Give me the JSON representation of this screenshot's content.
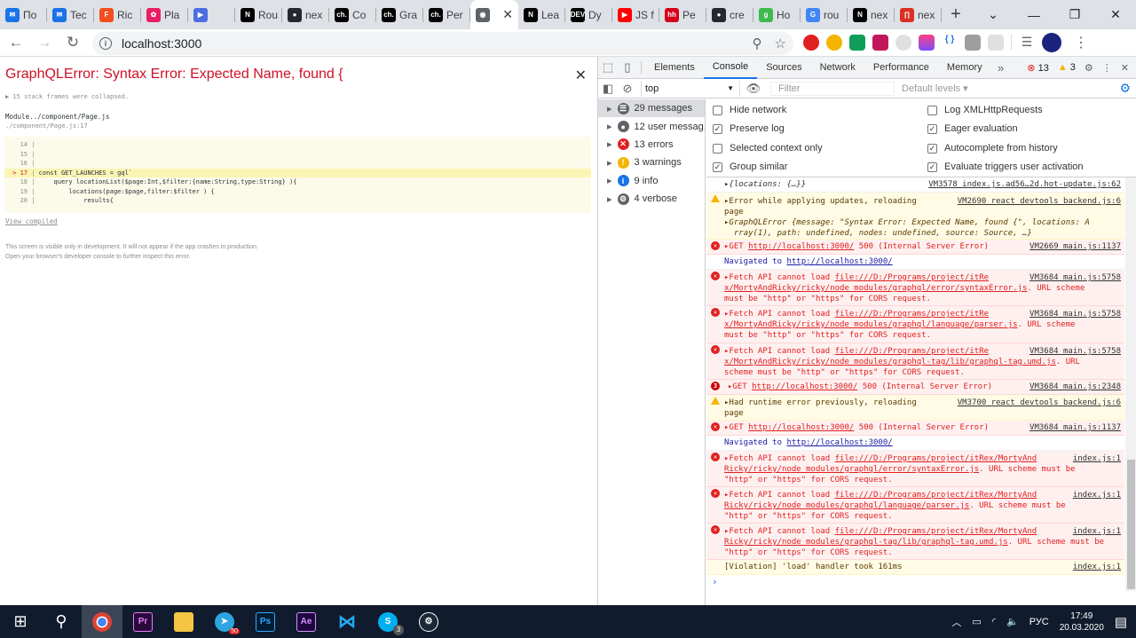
{
  "tabs": [
    {
      "label": "По",
      "color": "#1a73e8",
      "glyph": "✉"
    },
    {
      "label": "Tec",
      "color": "#1a73e8",
      "glyph": "✉"
    },
    {
      "label": "Ric",
      "color": "#f24e1e",
      "glyph": "F"
    },
    {
      "label": "Pla",
      "color": "#e91e63",
      "glyph": "✿"
    },
    {
      "label": "",
      "color": "#4a6ee0",
      "glyph": "▶"
    },
    {
      "label": "Rou",
      "color": "#000000",
      "glyph": "N"
    },
    {
      "label": "nex",
      "color": "#24292e",
      "glyph": "●"
    },
    {
      "label": "Co",
      "color": "#000000",
      "glyph": "ch."
    },
    {
      "label": "Gra",
      "color": "#000000",
      "glyph": "ch."
    },
    {
      "label": "Per",
      "color": "#000000",
      "glyph": "ch."
    },
    {
      "label": "",
      "color": "#5f6368",
      "glyph": "◉",
      "active": true
    },
    {
      "label": "Lea",
      "color": "#000000",
      "glyph": "N"
    },
    {
      "label": "Dy",
      "color": "#000000",
      "glyph": "DEV"
    },
    {
      "label": "JS f",
      "color": "#ff0000",
      "glyph": "▶"
    },
    {
      "label": "Pe",
      "color": "#d6001c",
      "glyph": "hh"
    },
    {
      "label": "cre",
      "color": "#24292e",
      "glyph": "●"
    },
    {
      "label": "Ho",
      "color": "#3dba4e",
      "glyph": "g"
    },
    {
      "label": "rou",
      "color": "#4285f4",
      "glyph": "G"
    },
    {
      "label": "nex",
      "color": "#000000",
      "glyph": "N"
    },
    {
      "label": "nex",
      "color": "#d93025",
      "glyph": "∏"
    }
  ],
  "toolbar": {
    "url": "localhost:3000"
  },
  "error_overlay": {
    "title": "GraphQLError: Syntax Error: Expected Name, found {",
    "collapsed": "▶ 15 stack frames were collapsed.",
    "module": "Module../component/Page.js",
    "module_path": "./component/Page.js:17",
    "code": [
      {
        "n": "14",
        "t": ""
      },
      {
        "n": "15",
        "t": ""
      },
      {
        "n": "16",
        "t": ""
      },
      {
        "n": "> 17",
        "t": "const GET_LAUNCHES = gql`"
      },
      {
        "n": "18",
        "t": "    query locationList($page:Int,$filter:{name:String,type:String} ){"
      },
      {
        "n": "19",
        "t": "        locations(page:$page,filter:$filter ) {"
      },
      {
        "n": "20",
        "t": "            results{"
      }
    ],
    "view_compiled": "View compiled",
    "note1": "This screen is visible only in development. It will not appear if the app crashes in production.",
    "note2": "Open your browser's developer console to further inspect this error."
  },
  "devtools": {
    "tabs": [
      "Elements",
      "Console",
      "Sources",
      "Network",
      "Performance",
      "Memory"
    ],
    "error_count": "13",
    "warn_count": "3",
    "context": "top",
    "filter_placeholder": "Filter",
    "levels": "Default levels ▾",
    "sidebar": [
      {
        "label": "29 messages",
        "icon": "☰",
        "color": "#5f6368"
      },
      {
        "label": "12 user messag...",
        "icon": "●",
        "color": "#5f6368"
      },
      {
        "label": "13 errors",
        "icon": "✕",
        "color": "#e02020"
      },
      {
        "label": "3 warnings",
        "icon": "!",
        "color": "#f4b400"
      },
      {
        "label": "9 info",
        "icon": "i",
        "color": "#1a73e8"
      },
      {
        "label": "4 verbose",
        "icon": "⚙",
        "color": "#5f6368"
      }
    ],
    "settings": {
      "hide_network": "Hide network",
      "preserve_log": "Preserve log",
      "selected_context": "Selected context only",
      "group_similar": "Group similar",
      "log_xhr": "Log XMLHttpRequests",
      "eager_eval": "Eager evaluation",
      "autocomplete": "Autocomplete from history",
      "eval_triggers": "Evaluate triggers user activation"
    },
    "messages": {
      "m0_text": "▸{locations: {…}}",
      "m0_src": "VM3578 index.js.ad56…2d.hot-update.js:62",
      "m1_text": "▸Error while applying updates, reloading",
      "m1_src": "VM2690 react devtools backend.js:6",
      "m1_text2": "page",
      "m1_text3": "▸GraphQLError {message: \"Syntax Error: Expected Name, found {\", locations: A",
      "m1_text4": "  rray(1), path: undefined, nodes: undefined, source: Source, …}",
      "m2_text": "▸GET",
      "m2_url": "http://localhost:3000/",
      "m2_rest": "500 (Internal Server Error)",
      "m2_src": "VM2669 main.js:1137",
      "m3_text": "Navigated to",
      "m3_url": "http://localhost:3000/",
      "m4_a": "▸Fetch API cannot load",
      "m4_b": "file:///D:/Programs/project/itRe",
      "m4_src": "VM3684 main.js:5758",
      "m4_c": "x/MortyAndRicky/ricky/node_modules/graphql/error/syntaxError.js",
      "m4_d": ". URL scheme",
      "m4_e": "must be \"http\" or \"https\" for CORS request.",
      "m5_a": "▸Fetch API cannot load",
      "m5_b": "file:///D:/Programs/project/itRe",
      "m5_src": "VM3684 main.js:5758",
      "m5_c": "x/MortyAndRicky/ricky/node_modules/graphql/language/parser.js",
      "m5_d": ". URL scheme",
      "m5_e": "must be \"http\" or \"https\" for CORS request.",
      "m6_a": "▸Fetch API cannot load",
      "m6_b": "file:///D:/Programs/project/itRe",
      "m6_src": "VM3684 main.js:5758",
      "m6_c": "x/MortyAndRicky/ricky/node_modules/graphql-tag/lib/graphql-tag.umd.js",
      "m6_d": ". URL",
      "m6_e": "scheme must be \"http\" or \"https\" for CORS request.",
      "m7_count": "3",
      "m7_text": "▸GET",
      "m7_url": "http://localhost:3000/",
      "m7_rest": "500 (Internal Server Error)",
      "m7_src": "VM3684 main.js:2348",
      "m8_text": "▸Had runtime error previously, reloading",
      "m8_src": "VM3700 react devtools backend.js:6",
      "m8_text2": "page",
      "m9_text": "▸GET",
      "m9_url": "http://localhost:3000/",
      "m9_rest": "500 (Internal Server Error)",
      "m9_src": "VM3684 main.js:1137",
      "m10_text": "Navigated to",
      "m10_url": "http://localhost:3000/",
      "m11_a": "▸Fetch API cannot load",
      "m11_b": "file:///D:/Programs/project/itRex/MortyAnd",
      "m11_src": "index.js:1",
      "m11_c": "Ricky/ricky/node_modules/graphql/error/syntaxError.js",
      "m11_d": ". URL scheme must be",
      "m11_e": "\"http\" or \"https\" for CORS request.",
      "m12_a": "▸Fetch API cannot load",
      "m12_b": "file:///D:/Programs/project/itRex/MortyAnd",
      "m12_src": "index.js:1",
      "m12_c": "Ricky/ricky/node_modules/graphql/language/parser.js",
      "m12_d": ". URL scheme must be",
      "m12_e": "\"http\" or \"https\" for CORS request.",
      "m13_a": "▸Fetch API cannot load",
      "m13_b": "file:///D:/Programs/project/itRex/MortyAnd",
      "m13_src": "index.js:1",
      "m13_c": "Ricky/ricky/node_modules/graphql-tag/lib/graphql-tag.umd.js",
      "m13_d": ". URL scheme must be",
      "m13_e": "\"http\" or \"https\" for CORS request.",
      "m14_text": "[Violation] 'load' handler took 161ms",
      "m14_src": "index.js:1"
    }
  },
  "taskbar": {
    "lang": "РУС",
    "time": "17:49",
    "date": "20.03.2020",
    "telegram_badge": "50",
    "skype_badge": "3"
  }
}
